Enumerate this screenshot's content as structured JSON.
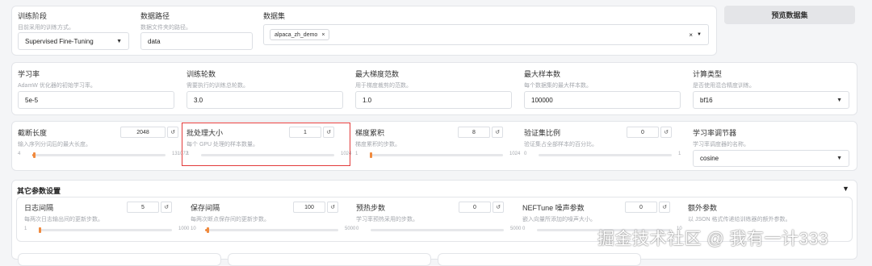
{
  "top": {
    "stage": {
      "label": "训练阶段",
      "desc": "目前采用的训练方式。",
      "value": "Supervised Fine-Tuning"
    },
    "path": {
      "label": "数据路径",
      "desc": "数据文件夹的路径。",
      "value": "data"
    },
    "dataset": {
      "label": "数据集",
      "tag": "alpaca_zh_demo",
      "tag_close": "×",
      "clear": "×"
    },
    "preview_button": "预览数据集"
  },
  "row2": [
    {
      "label": "学习率",
      "desc": "AdamW 优化器的初始学习率。",
      "value": "5e-5"
    },
    {
      "label": "训练轮数",
      "desc": "需要执行的训练总轮数。",
      "value": "3.0"
    },
    {
      "label": "最大梯度范数",
      "desc": "用于梯度裁剪的范数。",
      "value": "1.0"
    },
    {
      "label": "最大样本数",
      "desc": "每个数据集的最大样本数。",
      "value": "100000"
    },
    {
      "label": "计算类型",
      "desc": "是否使用混合精度训练。",
      "value": "bf16"
    }
  ],
  "row3": [
    {
      "label": "截断长度",
      "desc": "输入序列分词后的最大长度。",
      "value": "2048",
      "min": "4",
      "max": "131072",
      "progress": 0.015
    },
    {
      "label": "批处理大小",
      "desc": "每个 GPU 处理的样本数量。",
      "value": "1",
      "min": "1",
      "max": "1024",
      "progress": 0.0
    },
    {
      "label": "梯度累积",
      "desc": "梯度累积的步数。",
      "value": "8",
      "min": "1",
      "max": "1024",
      "progress": 0.007
    },
    {
      "label": "验证集比例",
      "desc": "验证集占全部样本的百分比。",
      "value": "0",
      "min": "0",
      "max": "1",
      "progress": 0.0
    }
  ],
  "scheduler": {
    "label": "学习率调节器",
    "desc": "学习率调度器的名称。",
    "value": "cosine"
  },
  "other": {
    "title": "其它参数设置",
    "collapse": "▼",
    "items": [
      {
        "label": "日志间隔",
        "desc": "每两次日志输出间的更新步数。",
        "value": "5",
        "min": "1",
        "max": "1000",
        "progress": 0.004
      },
      {
        "label": "保存间隔",
        "desc": "每两次断点保存间的更新步数。",
        "value": "100",
        "min": "10",
        "max": "5000",
        "progress": 0.018
      },
      {
        "label": "预热步数",
        "desc": "学习率预热采用的步数。",
        "value": "0",
        "min": "0",
        "max": "5000",
        "progress": 0.0
      },
      {
        "label": "NEFTune 噪声参数",
        "desc": "嵌入向量所添加的噪声大小。",
        "value": "0",
        "min": "0",
        "max": "10",
        "progress": 0.0
      }
    ],
    "extra": {
      "label": "额外参数",
      "desc": "以 JSON 格式传递给训练器的额外参数。"
    }
  },
  "icons": {
    "reset": "↺",
    "dropdown": "▼"
  },
  "watermark": "掘金技术社区 @ 我有一计333",
  "colors": {
    "accent": "#f08a3e",
    "highlight": "#e23b3b"
  }
}
